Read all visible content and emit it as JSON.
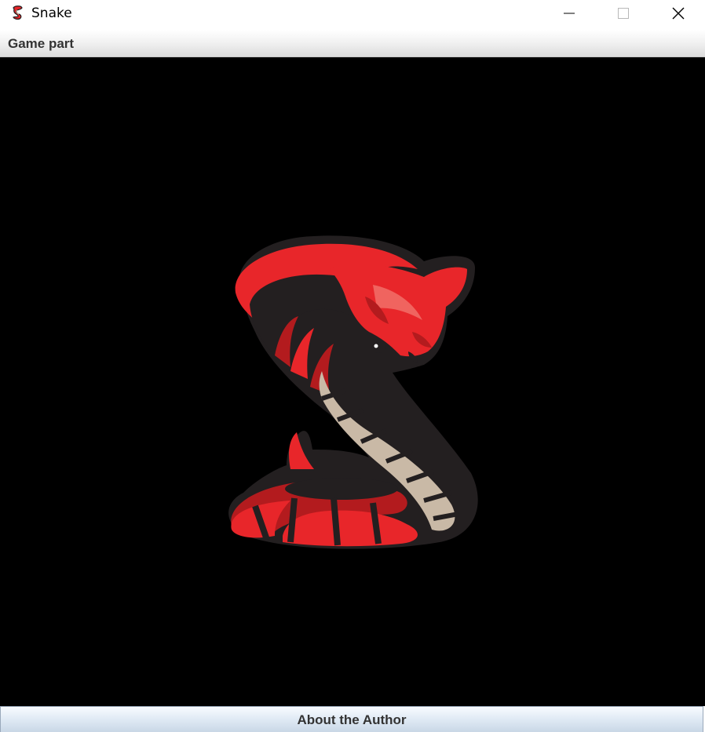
{
  "window": {
    "title": "Snake",
    "icon": "cobra-snake-icon",
    "controls": [
      "minimize-icon",
      "maximize-icon",
      "close-icon"
    ]
  },
  "menu": {
    "items": [
      {
        "label": "Game part"
      }
    ]
  },
  "game": {
    "background": "#000000",
    "logo": "cobra-snake-logo",
    "colors": {
      "snake_red": "#e8262a",
      "snake_dark_red": "#b31b1e",
      "belly": "#c9b9a6",
      "outline": "#231f20"
    }
  },
  "footer": {
    "about_label": "About the Author"
  }
}
